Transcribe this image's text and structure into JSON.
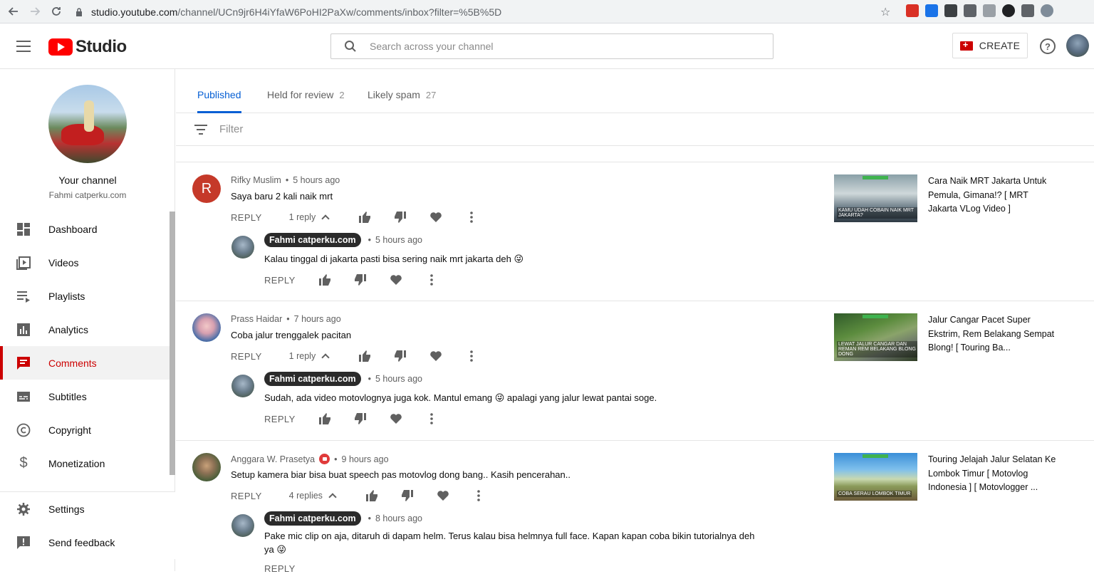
{
  "browser": {
    "url_host": "studio.youtube.com",
    "url_path": "/channel/UCn9jr6H4iYfaW6PoHI2PaXw/comments/inbox?filter=%5B%5D"
  },
  "header": {
    "logo_text": "Studio",
    "search_placeholder": "Search across your channel",
    "create_label": "CREATE"
  },
  "sidebar": {
    "channel_name": "Your channel",
    "channel_handle": "Fahmi catperku.com",
    "items": [
      {
        "label": "Dashboard",
        "icon": "dashboard-icon"
      },
      {
        "label": "Videos",
        "icon": "videos-icon"
      },
      {
        "label": "Playlists",
        "icon": "playlists-icon"
      },
      {
        "label": "Analytics",
        "icon": "analytics-icon"
      },
      {
        "label": "Comments",
        "icon": "comments-icon",
        "active": true
      },
      {
        "label": "Subtitles",
        "icon": "subtitles-icon"
      },
      {
        "label": "Copyright",
        "icon": "copyright-icon"
      },
      {
        "label": "Monetization",
        "icon": "monetization-icon"
      }
    ],
    "bottom_items": [
      {
        "label": "Settings",
        "icon": "gear-icon"
      },
      {
        "label": "Send feedback",
        "icon": "feedback-icon"
      }
    ]
  },
  "tabs": [
    {
      "label": "Published",
      "count": "",
      "active": true
    },
    {
      "label": "Held for review",
      "count": "2"
    },
    {
      "label": "Likely spam",
      "count": "27"
    }
  ],
  "filter": {
    "placeholder": "Filter"
  },
  "reply_label": "REPLY",
  "comments": [
    {
      "author": "Rifky Muslim",
      "time": "5 hours ago",
      "text": "Saya baru 2 kali naik mrt",
      "replies_label": "1 reply",
      "avatar_letter": "R",
      "reply": {
        "author": "Fahmi catperku.com",
        "time": "5 hours ago",
        "text": "Kalau tinggal di jakarta pasti bisa sering naik mrt jakarta deh 😜"
      },
      "video_title": "Cara Naik MRT Jakarta Untuk Pemula, Gimana!? [ MRT Jakarta VLog Video ]",
      "thumb_caption": "KAMU UDAH COBAIN NAIK MRT JAKARTA?"
    },
    {
      "author": "Prass Haidar",
      "time": "7 hours ago",
      "text": "Coba jalur trenggalek pacitan",
      "replies_label": "1 reply",
      "reply": {
        "author": "Fahmi catperku.com",
        "time": "5 hours ago",
        "text": "Sudah, ada video motovlognya juga kok. Mantul emang 😜 apalagi yang jalur lewat pantai soge."
      },
      "video_title": "Jalur Cangar Pacet Super Ekstrim, Rem Belakang Sempat Blong! [ Touring Ba...",
      "thumb_caption": "LEWAT JALUR CANGAR DAN REMAN REM BELAKANG BLONG DONG"
    },
    {
      "author": "Anggara W. Prasetya",
      "time": "9 hours ago",
      "text": "Setup kamera biar bisa buat speech pas motovlog dong bang.. Kasih pencerahan..",
      "replies_label": "4 replies",
      "reply": {
        "author": "Fahmi catperku.com",
        "time": "8 hours ago",
        "text": "Pake mic clip on aja, ditaruh di dapam helm. Terus kalau bisa helmnya full face. Kapan kapan coba bikin tutorialnya deh ya 😜"
      },
      "video_title": "Touring Jelajah Jalur Selatan Ke Lombok Timur [ Motovlog Indonesia ] [ Motovlogger ...",
      "thumb_caption": "COBA SERAU LOMBOK TIMUR"
    }
  ],
  "colors": {
    "accent_blue": "#065fd4",
    "active_red": "#cc0000",
    "brand_red": "#ff0000"
  }
}
